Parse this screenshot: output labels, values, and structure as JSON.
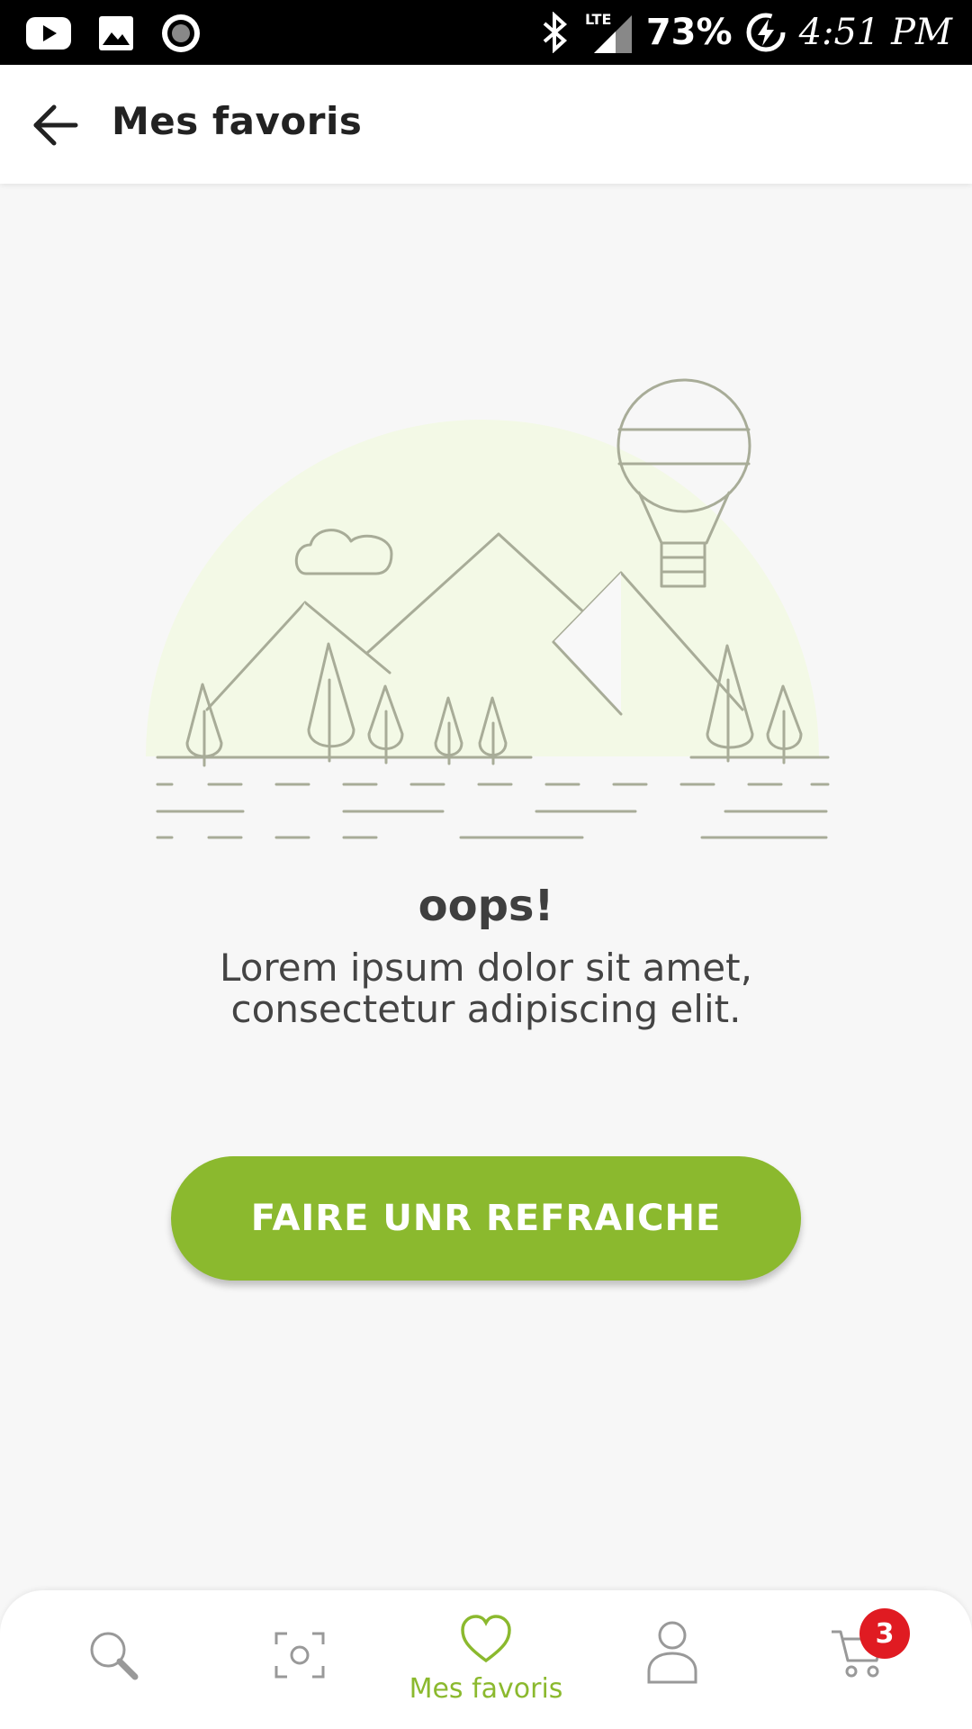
{
  "status_bar": {
    "battery": "73%",
    "time": "4:51 PM",
    "network": "LTE",
    "icons": [
      "youtube-icon",
      "gallery-icon",
      "record-icon",
      "bluetooth-icon",
      "signal-icon",
      "battery-charging-icon"
    ]
  },
  "header": {
    "back_icon": "arrow-left-icon",
    "title": "Mes favoris"
  },
  "empty_state": {
    "heading": "oops!",
    "message": "Lorem ipsum dolor sit amet, consectetur adipiscing elit.",
    "button_label": "FAIRE UNR REFRAICHE"
  },
  "bottom_nav": {
    "items": [
      {
        "icon": "search-icon",
        "label": ""
      },
      {
        "icon": "scan-icon",
        "label": ""
      },
      {
        "icon": "heart-icon",
        "label": "Mes favoris",
        "active": true
      },
      {
        "icon": "user-icon",
        "label": ""
      },
      {
        "icon": "cart-icon",
        "label": ""
      }
    ],
    "cart_badge": "3"
  },
  "colors": {
    "accent": "#8bb92e",
    "badge": "#e01b22",
    "illustration_stroke": "#a8ac98",
    "illustration_fill": "#f3f9e6"
  }
}
